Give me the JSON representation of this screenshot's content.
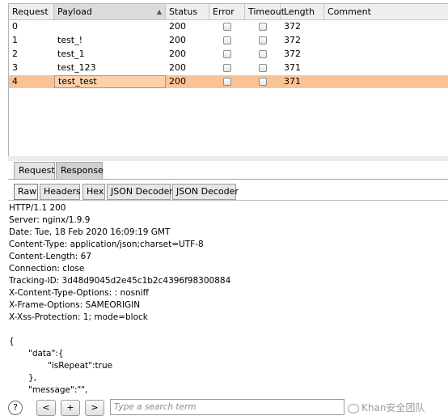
{
  "table": {
    "columns": [
      {
        "label": "Request"
      },
      {
        "label": "Payload"
      },
      {
        "label": "Status"
      },
      {
        "label": "Error"
      },
      {
        "label": "Timeout"
      },
      {
        "label": "Length"
      },
      {
        "label": "Comment"
      }
    ],
    "rows": [
      {
        "request": "0",
        "payload": "",
        "status": "200",
        "error": false,
        "timeout": false,
        "length": "372"
      },
      {
        "request": "1",
        "payload": "test_!",
        "status": "200",
        "error": false,
        "timeout": false,
        "length": "372"
      },
      {
        "request": "2",
        "payload": "test_1",
        "status": "200",
        "error": false,
        "timeout": false,
        "length": "372"
      },
      {
        "request": "3",
        "payload": "test_123",
        "status": "200",
        "error": false,
        "timeout": false,
        "length": "371"
      },
      {
        "request": "4",
        "payload": "test_test",
        "status": "200",
        "error": false,
        "timeout": false,
        "length": "371",
        "selected": true
      }
    ]
  },
  "tabs": [
    "Request",
    "Response"
  ],
  "subtabs": [
    "Raw",
    "Headers",
    "Hex",
    "JSON Decoder",
    "JSON Decoder"
  ],
  "response_lines": [
    "HTTP/1.1 200",
    "Server: nginx/1.9.9",
    "Date: Tue, 18 Feb 2020 16:09:19 GMT",
    "Content-Type: application/json;charset=UTF-8",
    "Content-Length: 67",
    "Connection: close",
    "Tracking-ID: 3d48d9045d2e45c1b2c4396f98300884",
    "X-Content-Type-Options: : nosniff",
    "X-Frame-Options: SAMEORIGIN",
    "X-Xss-Protection: 1; mode=block",
    "",
    "{",
    "\"data\":{",
    "\"isRepeat\":true",
    "},",
    "\"message\":\"\","
  ],
  "footer": {
    "help": "?",
    "prev": "<",
    "add": "+",
    "next": ">",
    "search_placeholder": "Type a search term",
    "watermark": "Khan安全团队"
  },
  "colors": {
    "selected_row": "#f9c395",
    "header_bg": "#efefef"
  }
}
